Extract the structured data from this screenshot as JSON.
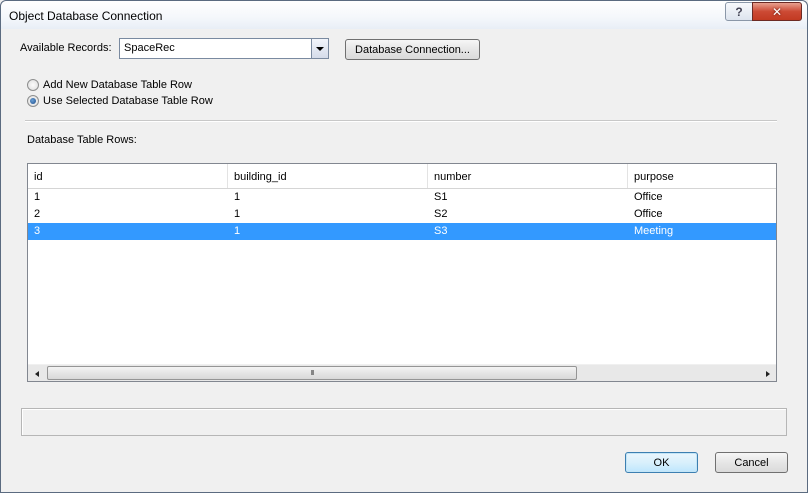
{
  "window": {
    "title": "Object Database Connection",
    "help_label": "?",
    "close_label": "✕"
  },
  "records": {
    "label": "Available Records:",
    "selected": "SpaceRec"
  },
  "db_connection_button": "Database Connection...",
  "options": {
    "add_new": "Add New Database Table Row",
    "use_selected": "Use Selected Database Table Row",
    "selected_option": "use_selected"
  },
  "table": {
    "label": "Database Table Rows:",
    "columns": [
      "id",
      "building_id",
      "number",
      "purpose"
    ],
    "rows": [
      [
        "1",
        "1",
        "S1",
        "Office"
      ],
      [
        "2",
        "1",
        "S2",
        "Office"
      ],
      [
        "3",
        "1",
        "S3",
        "Meeting"
      ]
    ],
    "selected_row": 2,
    "scroll_grip": "III"
  },
  "footer": {
    "ok_label": "OK",
    "cancel_label": "Cancel"
  },
  "colors": {
    "selection": "#3399ff",
    "close_button": "#c23a22"
  },
  "icons": [
    "help-icon",
    "close-icon",
    "chevron-down-icon",
    "scroll-left-icon",
    "scroll-right-icon"
  ]
}
